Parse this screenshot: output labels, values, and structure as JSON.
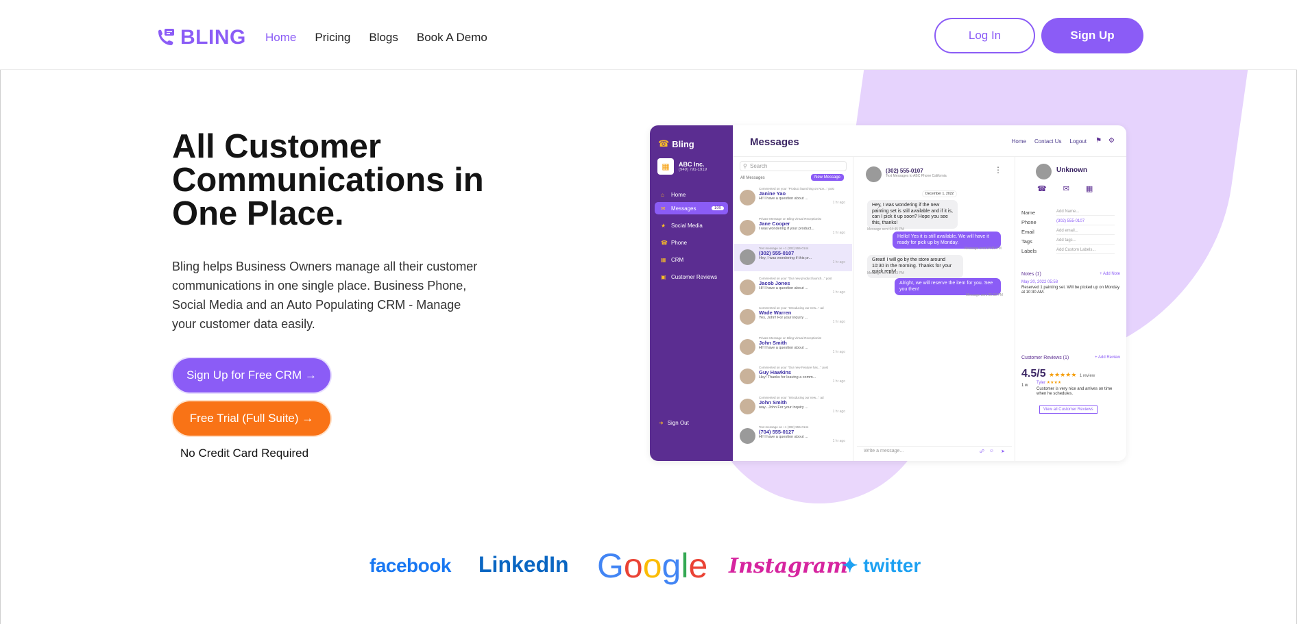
{
  "brand": {
    "name": "BLING",
    "accent": "#8b5cf6",
    "orange": "#f97316"
  },
  "nav": {
    "items": [
      "Home",
      "Pricing",
      "Blogs",
      "Book A Demo"
    ],
    "login": "Log In",
    "signup": "Sign Up"
  },
  "hero": {
    "title": "All Customer Communications in One Place.",
    "description": "Bling helps Business Owners manage all their customer communications in one single place. Business Phone, Social Media and an Auto Populating CRM - Manage your customer data easily.",
    "cta_crm": "Sign Up for Free CRM →",
    "cta_trial": "Free Trial (Full Suite) →",
    "no_cc": "No Credit Card Required"
  },
  "app": {
    "logo": "Bling",
    "company_name": "ABC Inc.",
    "company_sub": "(949) 791-1919",
    "sidebar": [
      {
        "label": "Home",
        "icon": "home-icon"
      },
      {
        "label": "Messages",
        "icon": "messages-icon",
        "badge": "100"
      },
      {
        "label": "Social Media",
        "icon": "social-icon"
      },
      {
        "label": "Phone",
        "icon": "phone-icon"
      },
      {
        "label": "CRM",
        "icon": "crm-icon"
      },
      {
        "label": "Customer Reviews",
        "icon": "reviews-icon"
      }
    ],
    "sign_out": "Sign Out",
    "title": "Messages",
    "top_links": [
      "Home",
      "Contact Us",
      "Logout"
    ],
    "search_placeholder": "Search",
    "filter": "All Messages",
    "new_message": "New Message",
    "conversations": [
      {
        "meta": "Commented on your \"Product launching on Nov...\" post",
        "name": "Janine Yao",
        "snippet": "Hi! I have a question about ...",
        "time": "1 hr ago"
      },
      {
        "meta": "Private Message on Bling Virtual Receptionist",
        "name": "Jane Cooper",
        "snippet": "I was wondering if your product...",
        "time": "1 hr ago"
      },
      {
        "meta": "Text message on +1 (302) 555-0144",
        "name": "(302) 555-0107",
        "snippet": "Hey, I was wondering if this pr...",
        "time": "1 hr ago"
      },
      {
        "meta": "Commented on your \"Our new product launch...\" post",
        "name": "Jacob Jones",
        "snippet": "Hi! I have a question about ...",
        "time": "1 hr ago"
      },
      {
        "meta": "Commented on your \"Introducing our new...\" ad",
        "name": "Wade Warren",
        "snippet": "Yes, John! For your inquiry ...",
        "time": "1 hr ago"
      },
      {
        "meta": "Private Message on Bling Virtual Receptionist",
        "name": "John Smith",
        "snippet": "Hi! I have a question about ...",
        "time": "1 hr ago"
      },
      {
        "meta": "Commented on your \"Our new Feature has...\" post",
        "name": "Guy Hawkins",
        "snippet": "Hey! Thanks for leaving a comm...",
        "time": "1 hr ago"
      },
      {
        "meta": "Commented on your \"Introducing our new...\" ad",
        "name": "John Smith",
        "snippet": "way...John For your inquiry ...",
        "time": "1 hr ago"
      },
      {
        "meta": "Text message on +1 (302) 555-0144",
        "name": "(704) 555-0127",
        "snippet": "Hi! I have a question about ...",
        "time": "1 hr ago"
      }
    ],
    "chat": {
      "phone": "(302) 555-0107",
      "sub": "Text Messages to ABC Phone California",
      "date": "December 1, 2022",
      "messages": [
        {
          "dir": "in",
          "text": "Hey, I was wondering if the new painting set is still available and if it is, can I pick it up soon? Hope you see this, thanks!",
          "time": "Message sent 04:45 PM"
        },
        {
          "dir": "out",
          "text": "Hello! Yes it is still available. We will have it ready for pick up by Monday.",
          "time": "Message sent 04:50 PM"
        },
        {
          "dir": "in",
          "text": "Great! I will go by the store around 10:30 in the morning. Thanks for your quick reply!",
          "time": "Message sent 05:13 PM"
        },
        {
          "dir": "out",
          "text": "Alright, we will reserve the item for you. See you then!",
          "time": "Message sent 05:18 PM"
        }
      ],
      "composer_placeholder": "Write a message..."
    },
    "details": {
      "name": "Unknown",
      "fields": [
        {
          "label": "Name",
          "value": "Add Name..."
        },
        {
          "label": "Phone",
          "value": "(302) 555-0107"
        },
        {
          "label": "Email",
          "value": "Add email..."
        },
        {
          "label": "Tags",
          "value": "Add tags..."
        },
        {
          "label": "Labels",
          "value": "Add Custom Labels..."
        }
      ],
      "notes_title": "Notes (1)",
      "add_note": "+ Add Note",
      "note_date": "May 20, 2022 05:58",
      "note_text": "Reserved 1 painting set. Will be picked up on Monday at 10:30 AM.",
      "reviews_title": "Customer Reviews (1)",
      "add_review": "+ Add Review",
      "rating": "4.5/5",
      "review_count": "1 review",
      "reviewer": "Tyler",
      "review_age": "1 w",
      "review_text": "Customer is very nice and arrives on time when he schedules.",
      "view_all": "View all Customer Reviews"
    }
  },
  "brands": [
    "facebook",
    "LinkedIn",
    "Google",
    "Instagram",
    "twitter"
  ]
}
